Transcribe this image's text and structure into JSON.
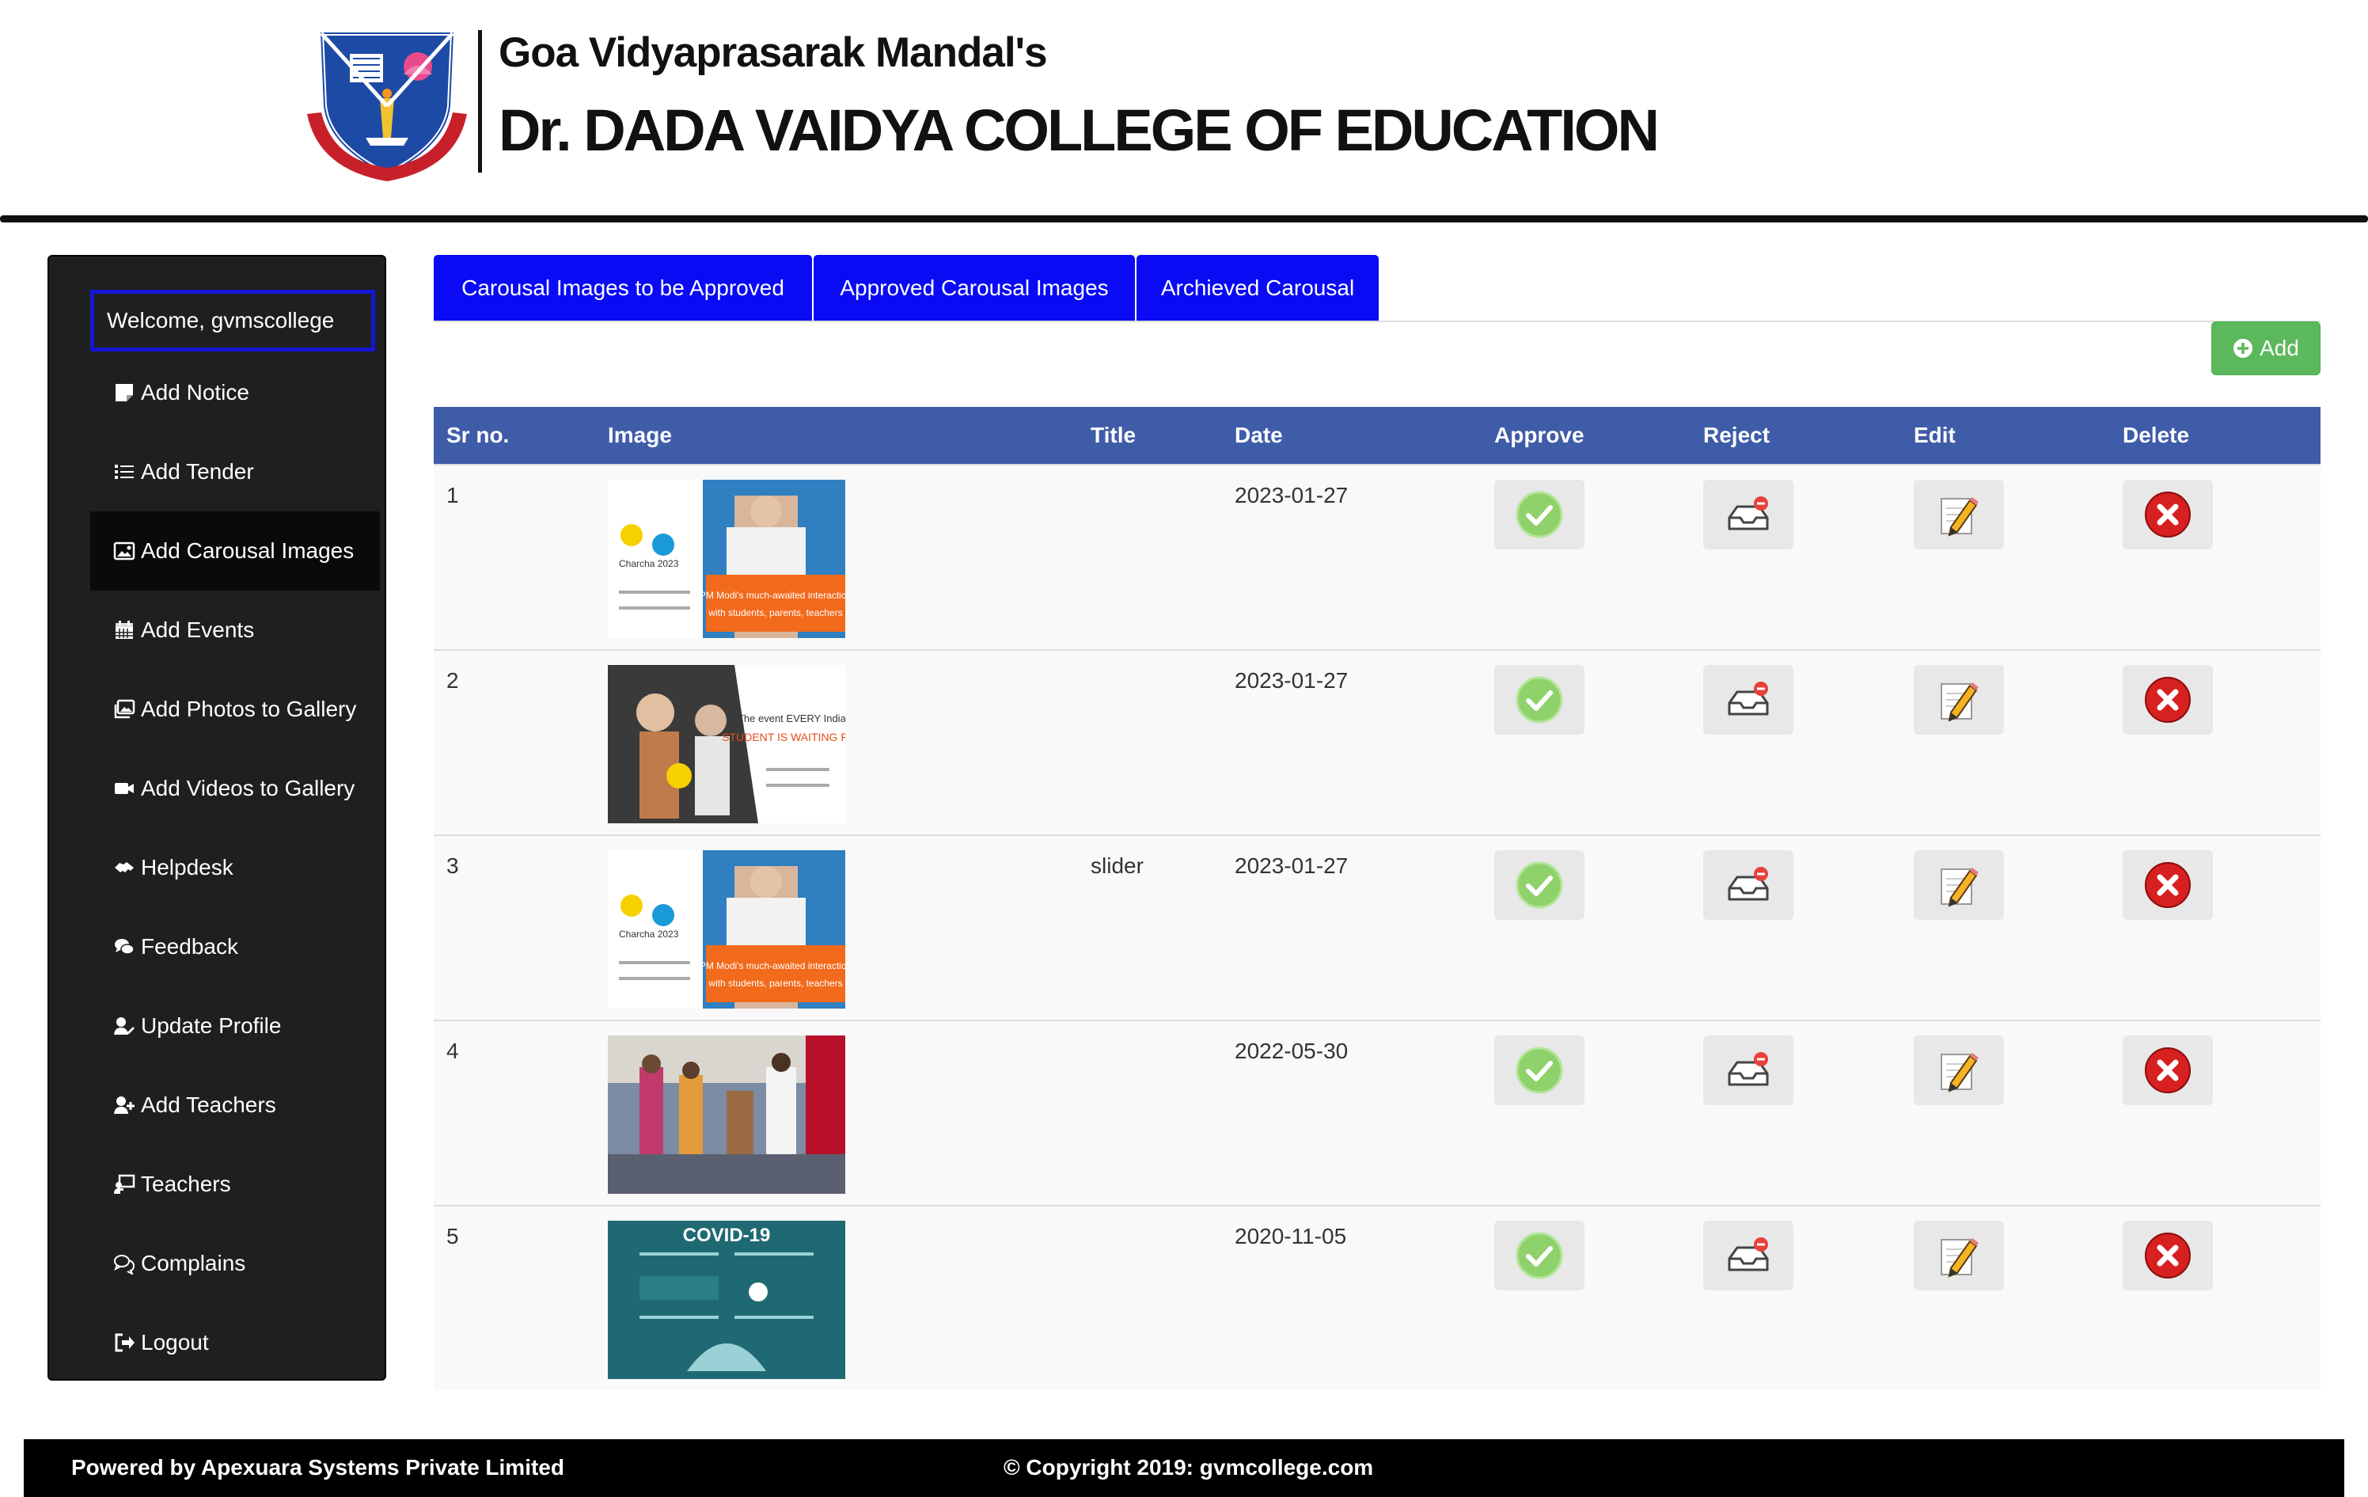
{
  "header": {
    "org_name": "Goa Vidyaprasarak Mandal's",
    "college_name": "Dr. DADA VAIDYA COLLEGE OF EDUCATION"
  },
  "sidebar": {
    "welcome": "Welcome, gvmscollege",
    "items": [
      {
        "label": "Add Notice",
        "icon": "sticky-note-icon"
      },
      {
        "label": "Add Tender",
        "icon": "list-icon"
      },
      {
        "label": "Add Carousal Images",
        "icon": "image-icon",
        "active": true
      },
      {
        "label": "Add Events",
        "icon": "calendar-icon"
      },
      {
        "label": "Add Photos to Gallery",
        "icon": "images-icon"
      },
      {
        "label": "Add Videos to Gallery",
        "icon": "video-icon"
      },
      {
        "label": "Helpdesk",
        "icon": "handshake-icon"
      },
      {
        "label": "Feedback",
        "icon": "comments-icon"
      },
      {
        "label": "Update Profile",
        "icon": "user-edit-icon"
      },
      {
        "label": "Add Teachers",
        "icon": "user-plus-icon"
      },
      {
        "label": "Teachers",
        "icon": "chalkboard-teacher-icon"
      },
      {
        "label": "Complains",
        "icon": "comments-outline-icon"
      },
      {
        "label": "Logout",
        "icon": "sign-out-icon"
      }
    ]
  },
  "tabs": [
    {
      "label": "Carousal Images to be Approved"
    },
    {
      "label": "Approved Carousal Images"
    },
    {
      "label": "Archieved Carousal"
    }
  ],
  "add_button": {
    "label": "Add",
    "icon": "plus-circle-icon"
  },
  "table": {
    "columns": [
      "Sr no.",
      "Image",
      "Title",
      "Date",
      "Approve",
      "Reject",
      "Edit",
      "Delete"
    ],
    "rows": [
      {
        "sr": "1",
        "title": "",
        "date": "2023-01-27",
        "thumb": "pariksha-pe-charcha-banner"
      },
      {
        "sr": "2",
        "title": "",
        "date": "2023-01-27",
        "thumb": "pariksha-student-banner"
      },
      {
        "sr": "3",
        "title": "slider",
        "date": "2023-01-27",
        "thumb": "pariksha-pe-charcha-banner"
      },
      {
        "sr": "4",
        "title": "",
        "date": "2022-05-30",
        "thumb": "event-photo"
      },
      {
        "sr": "5",
        "title": "",
        "date": "2020-11-05",
        "thumb": "covid-19-poster"
      }
    ],
    "covid_poster_text": "COVID-19"
  },
  "footer": {
    "powered_by": "Powered by Apexuara Systems Private Limited",
    "copyright": "© Copyright 2019: gvmcollege.com"
  },
  "colors": {
    "tab_blue": "#0a0af5",
    "table_header": "#3f5ca8",
    "add_green": "#5cb85c",
    "sidebar_bg": "#1f1f1f",
    "welcome_border": "#1515d4"
  }
}
